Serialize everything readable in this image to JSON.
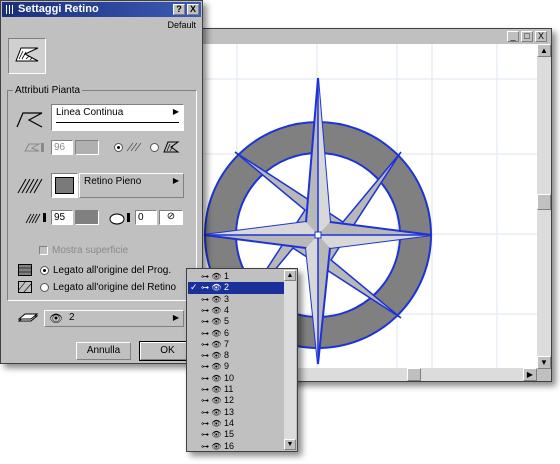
{
  "dialog": {
    "title": "Settaggi Retino",
    "help_button": "?",
    "close_button": "X",
    "default_label": "Default",
    "section_label": "Attributi Pianta",
    "line_type": "Linea Continua",
    "pen_value_1": "96",
    "fill_type": "Retino Pieno",
    "fill_pen_value": "95",
    "bg_pen_value": "0",
    "show_area_label": "Mostra superficie",
    "origin_project_label": "Legato all'origine del Prog.",
    "origin_fill_label": "Legato all'origine del Retino",
    "layer_value": "2",
    "cancel_label": "Annulla",
    "ok_label": "OK"
  },
  "drawing_window": {
    "minimize": "_",
    "maximize": "□",
    "close": "X"
  },
  "layer_list": {
    "selected": "2",
    "items": [
      "1",
      "2",
      "3",
      "4",
      "5",
      "6",
      "7",
      "8",
      "9",
      "10",
      "11",
      "12",
      "13",
      "14",
      "15",
      "16"
    ]
  },
  "colors": {
    "title_bar": "#1a2f7a",
    "selection": "#1a2f9a",
    "window_face": "#c0c0c0",
    "shape_outline": "#1c33d6",
    "ring_fill": "#808080",
    "star_fill": "#b8b8b8"
  },
  "icons": {
    "eye": "eye-icon",
    "lock": "lock-icon",
    "check": "check-icon"
  }
}
